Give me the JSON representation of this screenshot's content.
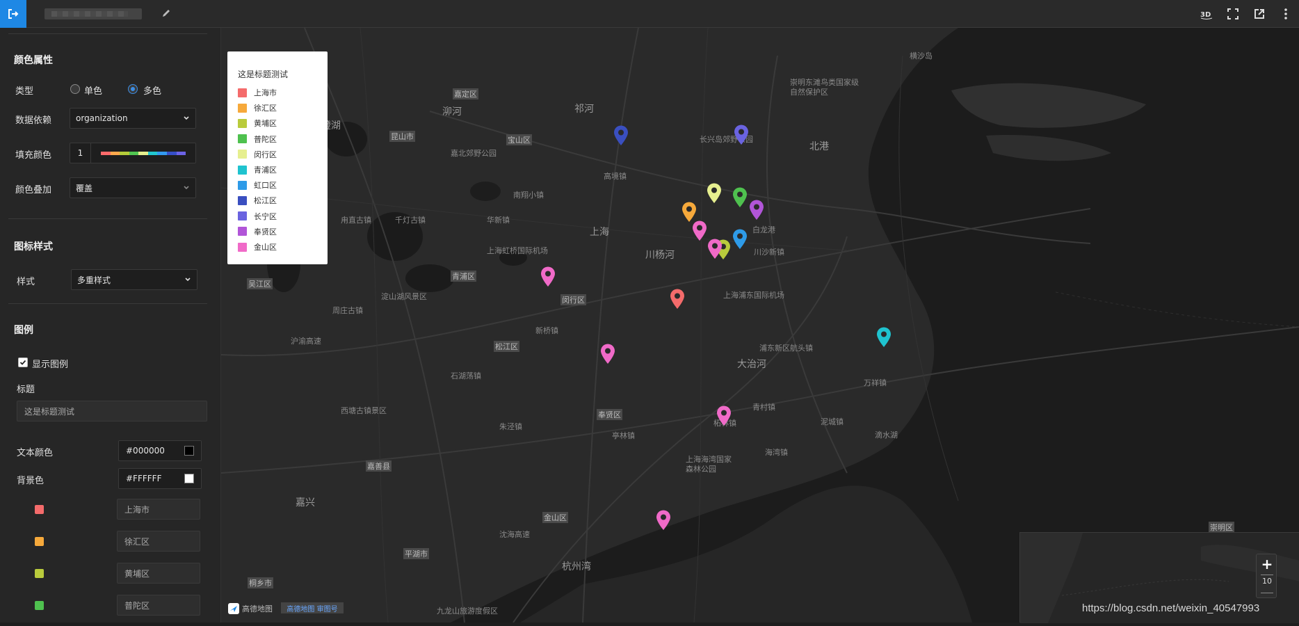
{
  "topbar": {
    "exit_icon": "exit-icon",
    "edit_icon": "pencil-icon",
    "right_icons": [
      "3d-icon",
      "fullscreen-icon",
      "external-link-icon",
      "more-vertical-icon"
    ]
  },
  "sidebar": {
    "color_props": {
      "title": "颜色属性",
      "type_label": "类型",
      "type_options": [
        "单色",
        "多色"
      ],
      "type_selected": "多色",
      "data_dep_label": "数据依赖",
      "data_dep_value": "organization",
      "fill_label": "填充颜色",
      "fill_count": "1",
      "fill_ramp": [
        "#ff6b6b",
        "#ffa94d",
        "#b5cc3a",
        "#51c651",
        "#e5ef8e",
        "#22c7d0",
        "#339af0",
        "#364fc7",
        "#6c63e6"
      ],
      "overlay_label": "颜色叠加",
      "overlay_value": "覆盖"
    },
    "icon_style": {
      "title": "图标样式",
      "style_label": "样式",
      "style_value": "多重样式"
    },
    "legend": {
      "title": "图例",
      "show_label": "显示图例",
      "show_checked": true,
      "heading_label": "标题",
      "heading_placeholder": "这是标题测试",
      "text_color_label": "文本颜色",
      "text_color_value": "#000000",
      "bg_color_label": "背景色",
      "bg_color_value": "#FFFFFF",
      "items": [
        {
          "color": "#f46b6b",
          "name": "上海市"
        },
        {
          "color": "#f6a93b",
          "name": "徐汇区"
        },
        {
          "color": "#b9cb3c",
          "name": "黄埔区"
        },
        {
          "color": "#4fc14f",
          "name": "普陀区"
        }
      ]
    }
  },
  "legend_panel": {
    "title": "这是标题测试",
    "items": [
      {
        "color": "#f46b6b",
        "name": "上海市"
      },
      {
        "color": "#f6a93b",
        "name": "徐汇区"
      },
      {
        "color": "#b9cb3c",
        "name": "黄埔区"
      },
      {
        "color": "#4fc14f",
        "name": "普陀区"
      },
      {
        "color": "#e6ef8f",
        "name": "闵行区"
      },
      {
        "color": "#1fc3cf",
        "name": "青浦区"
      },
      {
        "color": "#2e9be8",
        "name": "虹口区"
      },
      {
        "color": "#3a4fc0",
        "name": "松江区"
      },
      {
        "color": "#6a63e0",
        "name": "长宁区"
      },
      {
        "color": "#b155d8",
        "name": "奉贤区"
      },
      {
        "color": "#f06ac8",
        "name": "金山区"
      }
    ]
  },
  "map": {
    "places": [
      "上海",
      "川杨河",
      "嘉兴",
      "杭州湾",
      "大治河",
      "北港",
      "淀山湖风景区",
      "泖河",
      "祁河",
      "阳澄湖",
      "嘉北郊野公园",
      "上海虹桥国际机场",
      "上海浦东国际机场",
      "长兴岛郊野公园",
      "崇明东滩鸟类国家级自然保护区",
      "上海海湾国家森林公园",
      "九龙山旅游度假区",
      "周庄古镇",
      "甪直古镇",
      "千灯古镇",
      "西塘古镇景区",
      "沪渝高速",
      "沈海高速",
      "宝山区",
      "嘉定区",
      "昆山市",
      "吴江区",
      "青浦区",
      "闵行区",
      "松江区",
      "奉贤区",
      "金山区",
      "嘉善县",
      "平湖市",
      "桐乡市",
      "崇明区",
      "高境镇",
      "南翔小镇",
      "新桥镇",
      "华新镇",
      "石湖荡镇",
      "朱泾镇",
      "亭林镇",
      "柘林镇",
      "海湾镇",
      "青村镇",
      "泥城镇",
      "滴水湖",
      "万祥镇",
      "横沙岛",
      "白龙港",
      "川沙新镇",
      "浦东新区航头镇"
    ],
    "zoom_level": "10",
    "watermark": "https://blog.csdn.net/weixin_40547993",
    "logo_text": "高德地图",
    "scale_text": "高德地图 审图号"
  }
}
